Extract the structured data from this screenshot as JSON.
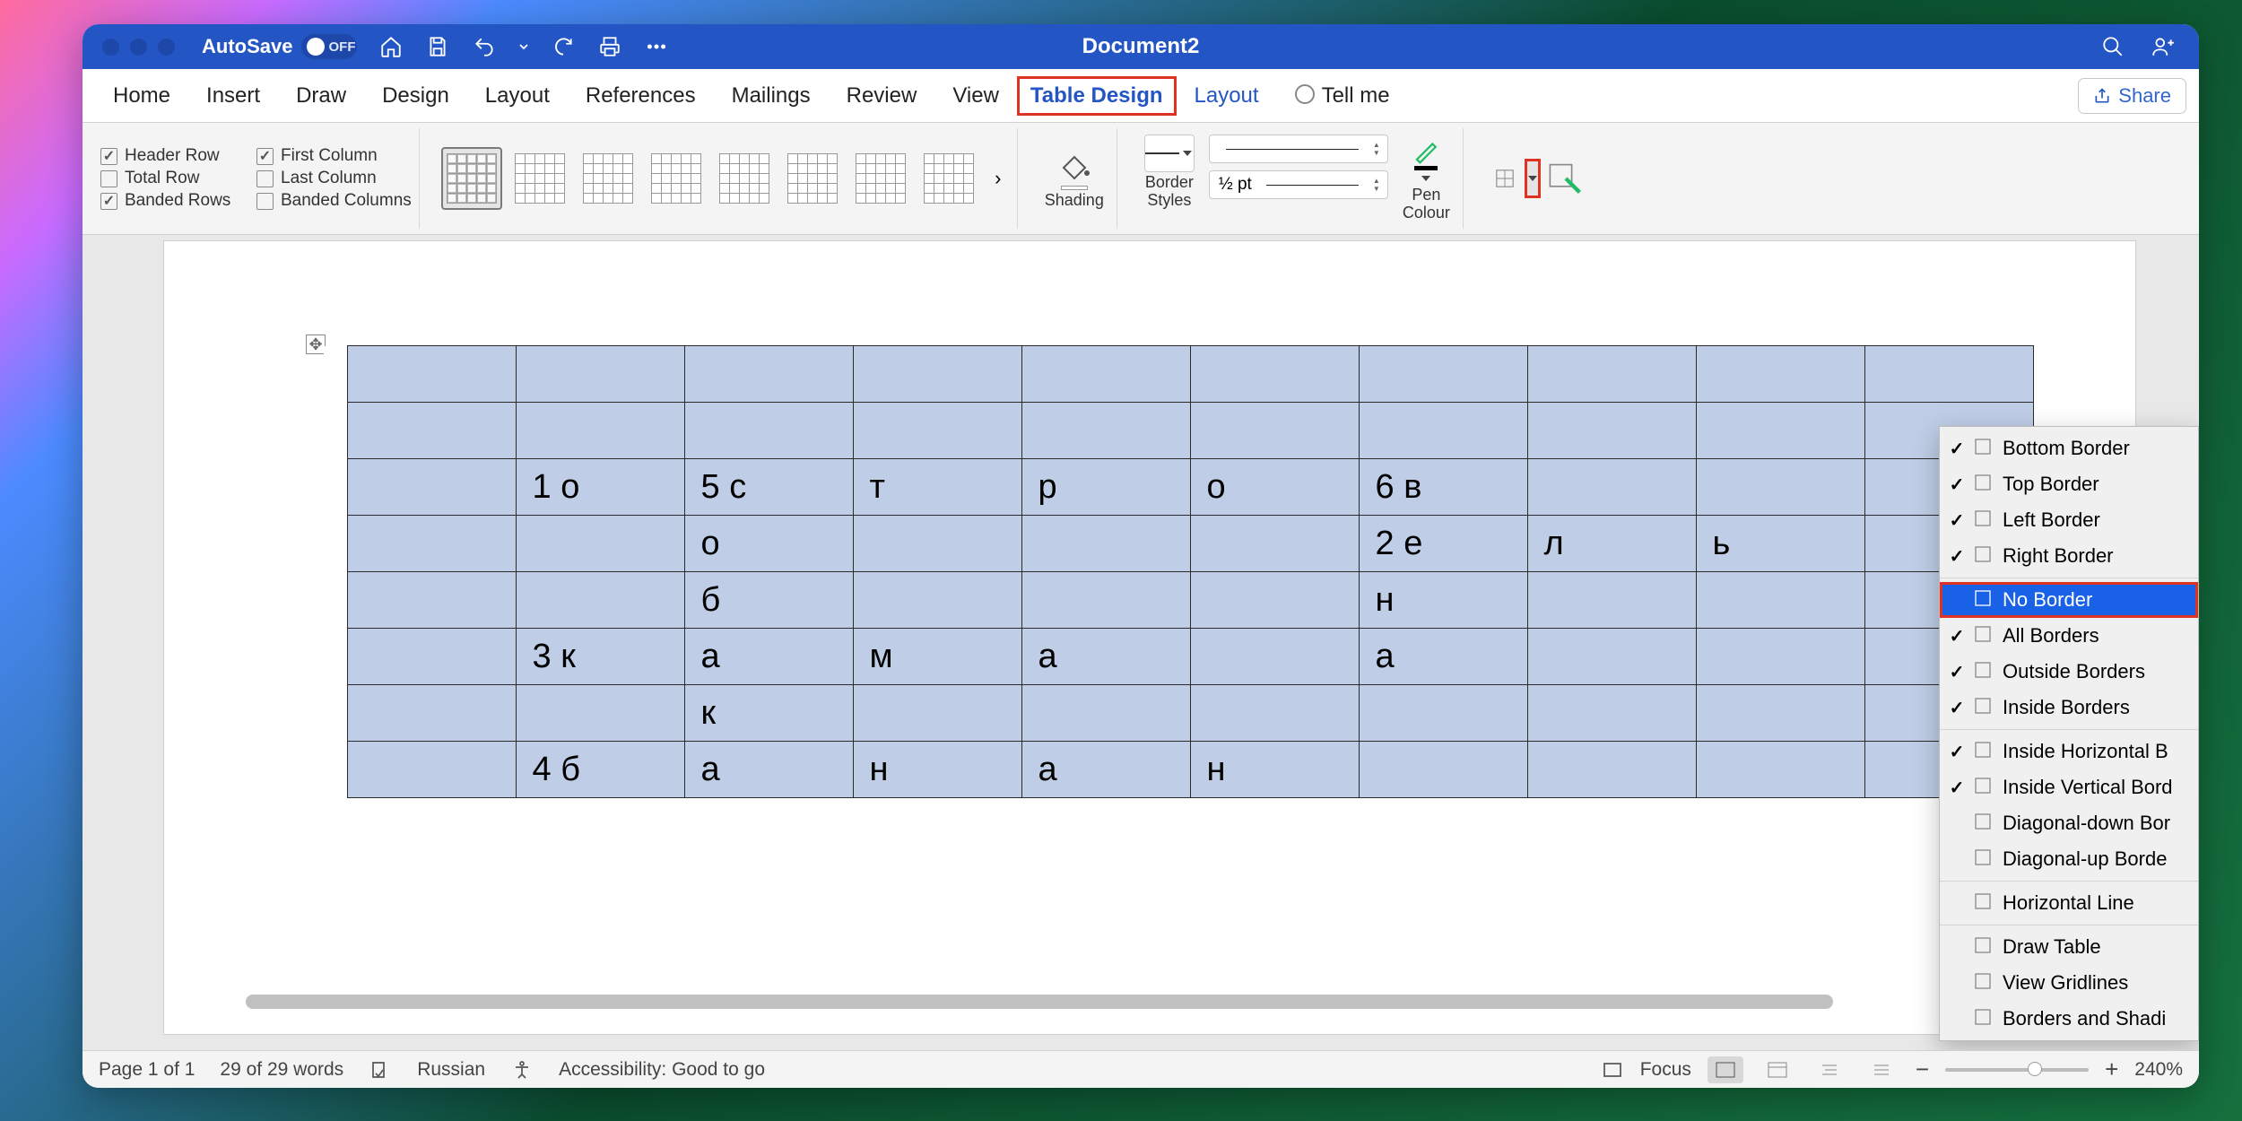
{
  "titlebar": {
    "autosave_label": "AutoSave",
    "autosave_state": "OFF",
    "doc_title": "Document2"
  },
  "tabs": {
    "items": [
      "Home",
      "Insert",
      "Draw",
      "Design",
      "Layout",
      "References",
      "Mailings",
      "Review",
      "View",
      "Table Design",
      "Layout",
      "Tell me"
    ],
    "active": "Table Design",
    "share": "Share"
  },
  "ribbon": {
    "options_left": [
      {
        "label": "Header Row",
        "checked": true
      },
      {
        "label": "Total Row",
        "checked": false
      },
      {
        "label": "Banded Rows",
        "checked": true
      }
    ],
    "options_right": [
      {
        "label": "First Column",
        "checked": true
      },
      {
        "label": "Last Column",
        "checked": false
      },
      {
        "label": "Banded Columns",
        "checked": false
      }
    ],
    "shading": "Shading",
    "border_styles": "Border\nStyles",
    "line_weight": "½ pt",
    "pen_colour": "Pen\nColour"
  },
  "menu": {
    "items": [
      {
        "label": "Bottom Border",
        "checked": true
      },
      {
        "label": "Top Border",
        "checked": true
      },
      {
        "label": "Left Border",
        "checked": true
      },
      {
        "label": "Right Border",
        "checked": true
      },
      {
        "label": "No Border",
        "checked": false,
        "selected": true,
        "highlight": true
      },
      {
        "label": "All Borders",
        "checked": true
      },
      {
        "label": "Outside Borders",
        "checked": true
      },
      {
        "label": "Inside Borders",
        "checked": true
      },
      {
        "label": "Inside Horizontal B",
        "checked": true
      },
      {
        "label": "Inside Vertical Bord",
        "checked": true
      },
      {
        "label": "Diagonal-down Bor",
        "checked": false
      },
      {
        "label": "Diagonal-up Borde",
        "checked": false
      },
      {
        "label": "Horizontal Line",
        "checked": false
      },
      {
        "label": "Draw Table",
        "checked": false
      },
      {
        "label": "View Gridlines",
        "checked": false
      },
      {
        "label": "Borders and Shadi",
        "checked": false
      }
    ]
  },
  "table": {
    "rows": [
      [
        "",
        "",
        "",
        "",
        "",
        "",
        "",
        "",
        "",
        ""
      ],
      [
        "",
        "",
        "",
        "",
        "",
        "",
        "",
        "",
        "",
        ""
      ],
      [
        "",
        "1 о",
        "5 с",
        "т",
        "р",
        "о",
        "6 в",
        "",
        "",
        ""
      ],
      [
        "",
        "",
        "о",
        "",
        "",
        "",
        "2 е",
        "л",
        "ь",
        ""
      ],
      [
        "",
        "",
        "б",
        "",
        "",
        "",
        "н",
        "",
        "",
        ""
      ],
      [
        "",
        "3 к",
        "а",
        "м",
        "а",
        "",
        "а",
        "",
        "",
        ""
      ],
      [
        "",
        "",
        "к",
        "",
        "",
        "",
        "",
        "",
        "",
        ""
      ],
      [
        "",
        "4 б",
        "а",
        "н",
        "а",
        "н",
        "",
        "",
        "",
        ""
      ]
    ]
  },
  "status": {
    "page": "Page 1 of 1",
    "words": "29 of 29 words",
    "lang": "Russian",
    "a11y": "Accessibility: Good to go",
    "focus": "Focus",
    "zoom": "240%"
  }
}
